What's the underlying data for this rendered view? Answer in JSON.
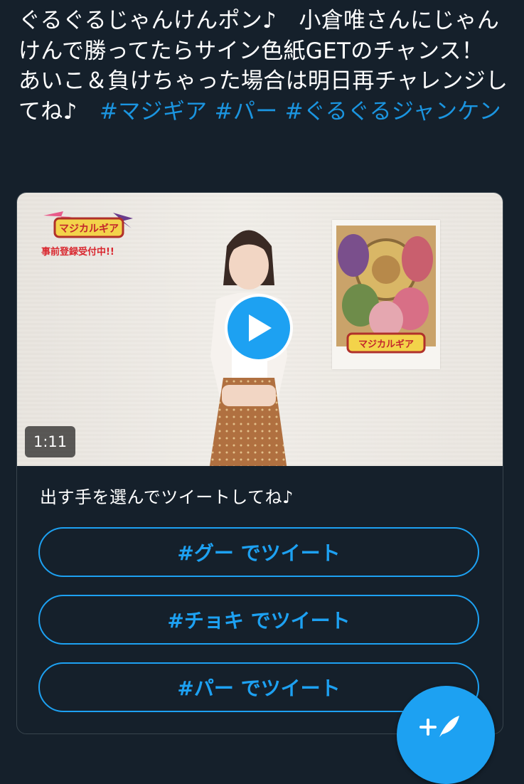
{
  "tweet": {
    "text_main": "ぐるぐるじゃんけんポン♪　小倉唯さんにじゃんけんで勝ってたらサイン色紙GETのチャンス！ あいこ＆負けちゃった場合は明日再チャレンジしてね♪　",
    "hashtag_1": "#マジギア",
    "hashtag_2": "#パー",
    "hashtag_3": "#ぐるぐるジャンケン"
  },
  "video": {
    "logo_text": "マジカルギア",
    "preregistration": "事前登録受付中!!",
    "poster_logo_text": "マジカルギア",
    "duration": "1:11"
  },
  "card": {
    "prompt": "出す手を選んでツイートしてね♪",
    "buttons": [
      "#グー でツイート",
      "#チョキ でツイート",
      "#パー でツイート"
    ]
  },
  "colors": {
    "background": "#15202b",
    "accent": "#1da1f2",
    "hashtag": "#1b95e0",
    "border": "#38444d"
  },
  "icons": {
    "play": "play-icon",
    "compose": "compose-tweet-icon"
  }
}
